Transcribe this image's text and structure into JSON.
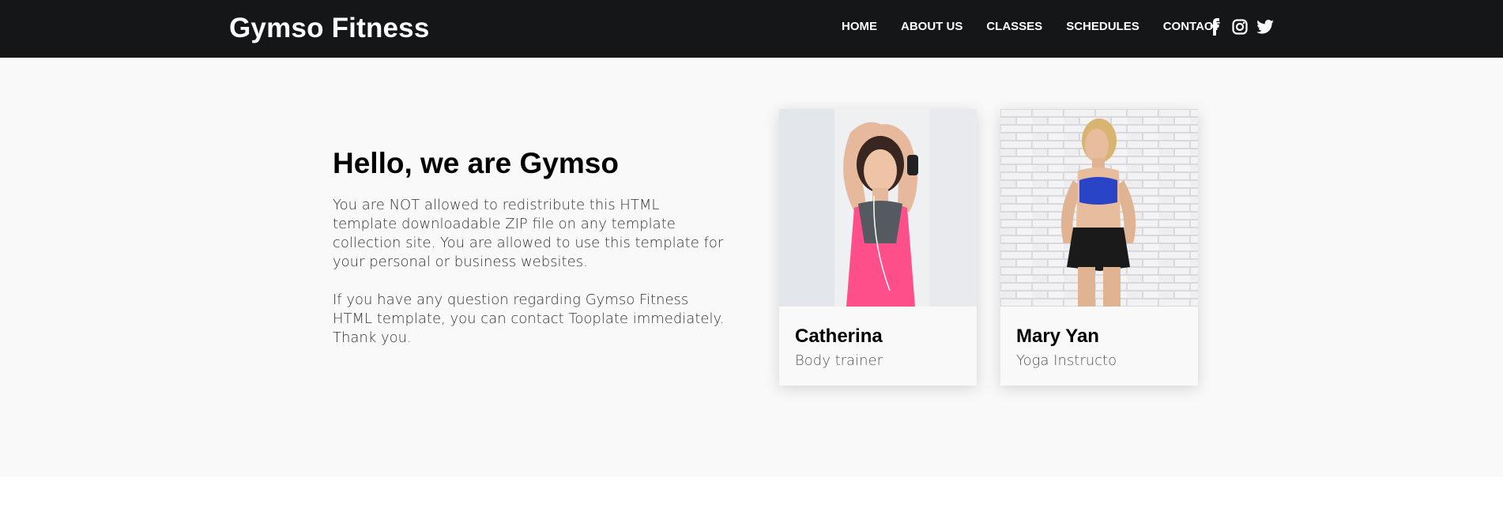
{
  "header": {
    "brand": "Gymso Fitness",
    "nav": [
      "HOME",
      "ABOUT US",
      "CLASSES",
      "SCHEDULES",
      "CONTACT"
    ],
    "social_icons": [
      "facebook-icon",
      "instagram-icon",
      "twitter-icon"
    ]
  },
  "about": {
    "title": "Hello, we are Gymso",
    "paragraph1": "You are NOT allowed to redistribute this HTML template downloadable ZIP file on any template collection site. You are allowed to use this template for your personal or business websites.",
    "paragraph2": "If you have any question regarding Gymso Fitness HTML template, you can contact Tooplate immediately. Thank you."
  },
  "trainers": [
    {
      "name": "Catherina",
      "role": "Body trainer"
    },
    {
      "name": "Mary Yan",
      "role": "Yoga Instructo"
    }
  ],
  "colors": {
    "navbar_bg": "#151617",
    "section_bg": "#f9f9f9",
    "pink_top": "#ff4f8b",
    "blue_top": "#2a44c8"
  }
}
